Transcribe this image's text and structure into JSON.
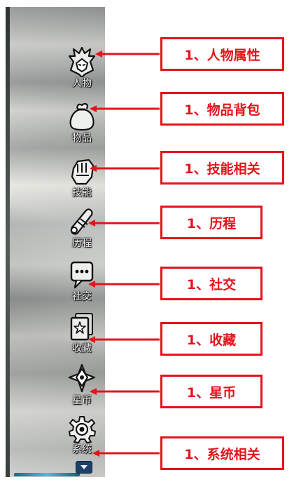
{
  "menu": {
    "items": [
      {
        "label": "人物",
        "icon": "character-helmet-icon"
      },
      {
        "label": "物品",
        "icon": "item-bag-icon"
      },
      {
        "label": "技能",
        "icon": "skill-fist-icon"
      },
      {
        "label": "历程",
        "icon": "journey-scroll-icon"
      },
      {
        "label": "社交",
        "icon": "social-chat-icon"
      },
      {
        "label": "收藏",
        "icon": "collection-card-icon"
      },
      {
        "label": "星币",
        "icon": "star-coin-icon"
      },
      {
        "label": "系统",
        "icon": "system-gear-icon"
      }
    ]
  },
  "annotations": [
    "1、人物属性",
    "1、物品背包",
    "1、技能相关",
    "1、历程",
    "1、社交",
    "1、收藏",
    "1、星币",
    "1、系统相关"
  ],
  "colors": {
    "annotation_red": "#e3141c",
    "label_text": "#f4f4f4",
    "expand_button": "#1d3f6a"
  }
}
